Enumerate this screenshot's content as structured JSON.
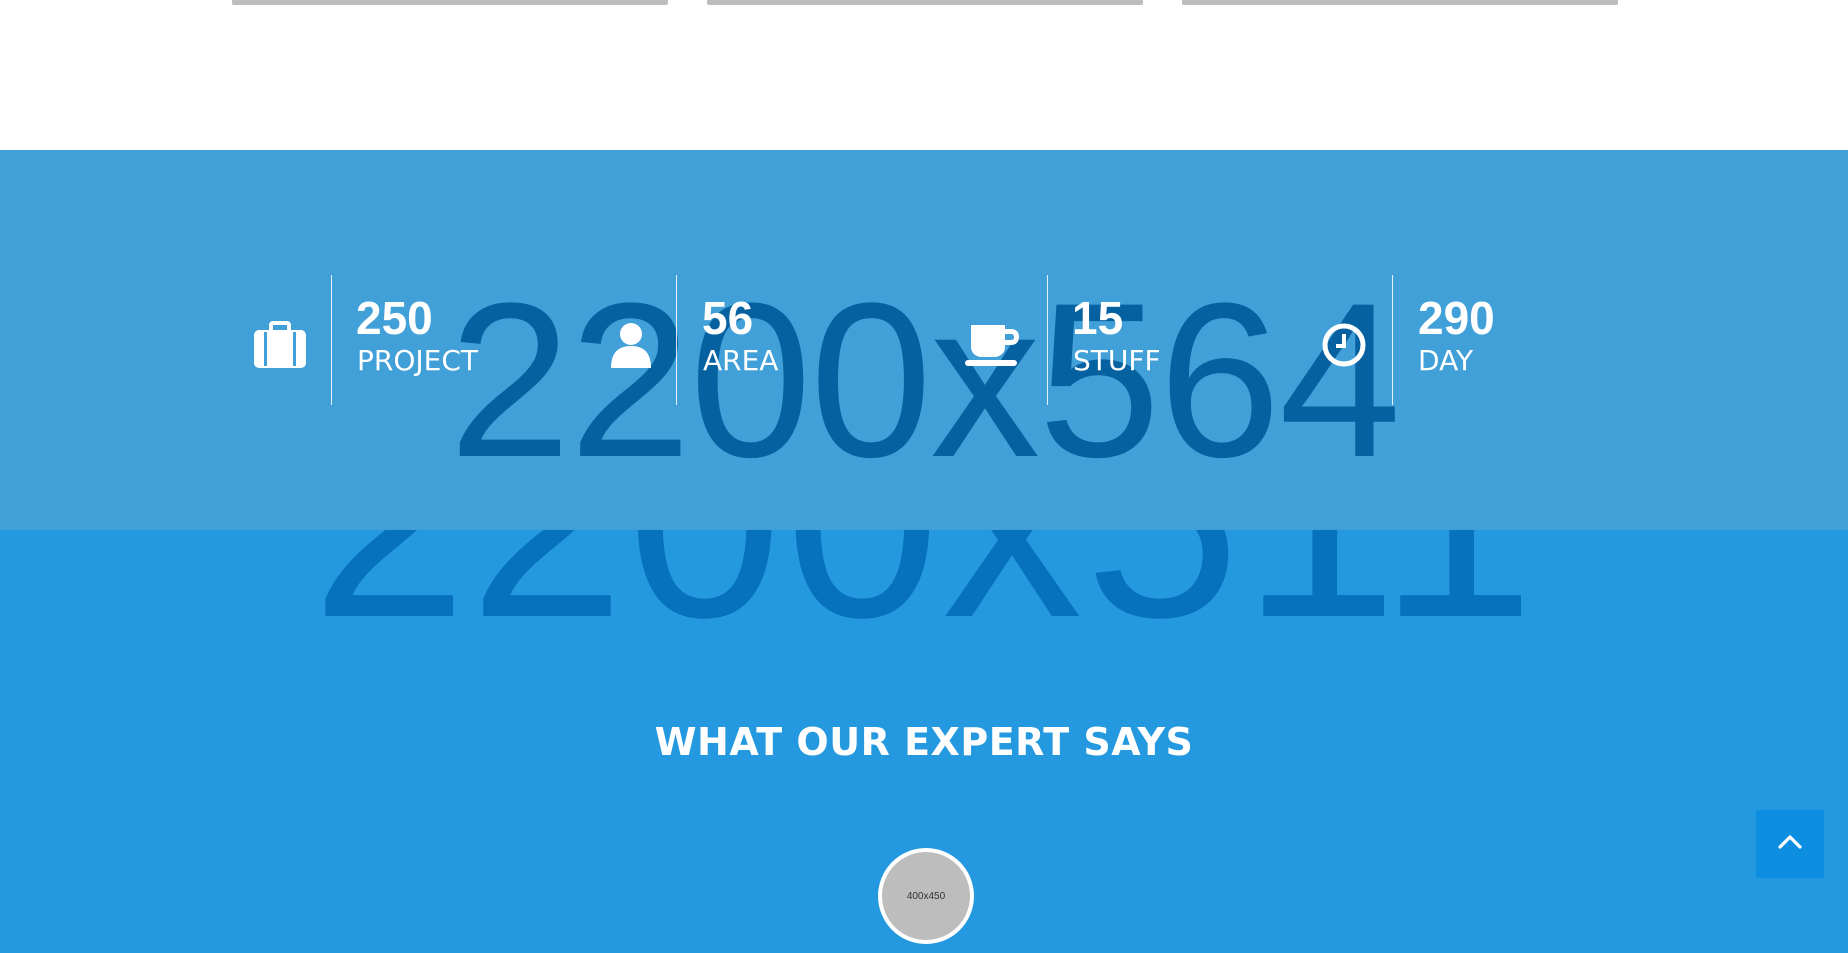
{
  "stats_background_placeholder": "2200x564",
  "testimonial_background_placeholder": "2200x511",
  "stats": [
    {
      "icon": "briefcase-icon",
      "number": "250",
      "label": "PROJECT"
    },
    {
      "icon": "user-icon",
      "number": "56",
      "label": "AREA"
    },
    {
      "icon": "coffee-icon",
      "number": "15",
      "label": "STUFF"
    },
    {
      "icon": "clock-icon",
      "number": "290",
      "label": "DAY"
    }
  ],
  "testimonials": {
    "title": "WHAT OUR EXPERT SAYS",
    "avatar_placeholder": "400x450"
  },
  "colors": {
    "stats_bg": "#42a0d8",
    "testimonial_bg": "#2599e0",
    "placeholder_text": "#0561a0",
    "back_to_top": "#0e8ee0"
  },
  "back_to_top_icon": "chevron-up-icon"
}
